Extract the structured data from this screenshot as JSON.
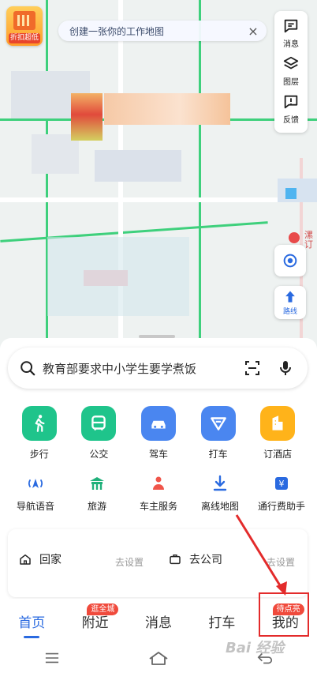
{
  "map": {
    "promo_label": "折扣超低",
    "promo_tag": "HOTEL",
    "tip_text": "创建一张你的工作地图",
    "tools": [
      {
        "icon": "message-icon",
        "label": "消息"
      },
      {
        "icon": "layers-icon",
        "label": "图层"
      },
      {
        "icon": "feedback-icon",
        "label": "反馈"
      }
    ],
    "side_text": "漯订",
    "route_label": "路线"
  },
  "search": {
    "placeholder": "教育部要求中小学生要学煮饭"
  },
  "primary_apps": [
    {
      "icon": "walk-icon",
      "label": "步行",
      "color": "#1fc48b"
    },
    {
      "icon": "bus-icon",
      "label": "公交",
      "color": "#1fc48b"
    },
    {
      "icon": "car-icon",
      "label": "驾车",
      "color": "#4a86f0"
    },
    {
      "icon": "taxi-icon",
      "label": "打车",
      "color": "#4a86f0"
    },
    {
      "icon": "hotel-icon",
      "label": "订酒店",
      "color": "#ffb31a"
    }
  ],
  "secondary_apps": [
    {
      "icon": "voice-nav-icon",
      "label": "导航语音"
    },
    {
      "icon": "travel-icon",
      "label": "旅游"
    },
    {
      "icon": "car-owner-icon",
      "label": "车主服务"
    },
    {
      "icon": "offline-map-icon",
      "label": "离线地图"
    },
    {
      "icon": "toll-icon",
      "label": "通行费助手"
    }
  ],
  "quick": {
    "home_label": "回家",
    "home_action": "去设置",
    "work_label": "去公司",
    "work_action": "去设置"
  },
  "tabs": [
    {
      "label": "首页",
      "active": true
    },
    {
      "label": "附近",
      "badge": "逛全城"
    },
    {
      "label": "消息"
    },
    {
      "label": "打车"
    },
    {
      "label": "我的",
      "badge": "待点亮"
    }
  ],
  "watermark": "Bai 经验",
  "colors": {
    "accent": "#2a6ae0",
    "badge": "#f04a3c",
    "annotation": "#e32b2b"
  }
}
